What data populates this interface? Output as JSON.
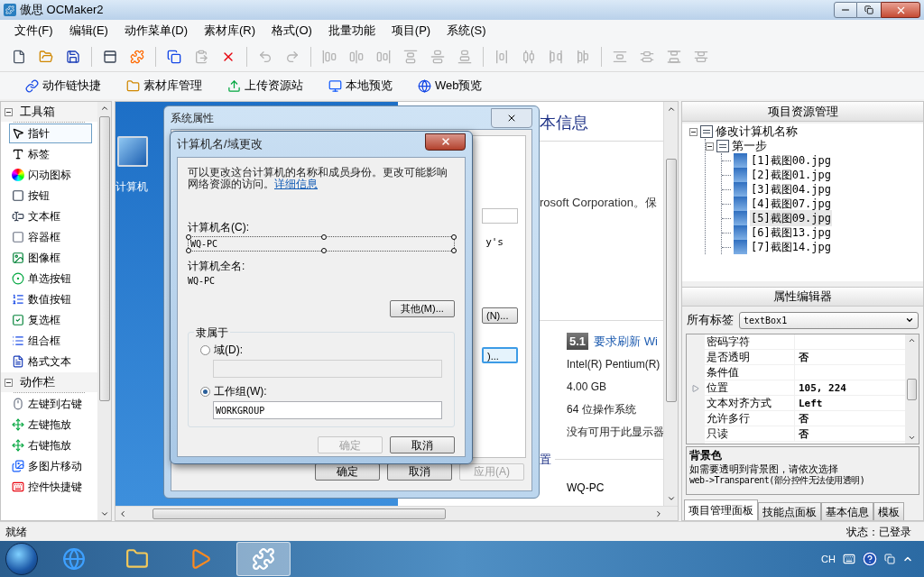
{
  "window": {
    "title": "傲思 OCMaker2"
  },
  "menu": [
    "文件(F)",
    "编辑(E)",
    "动作菜单(D)",
    "素材库(R)",
    "格式(O)",
    "批量功能",
    "项目(P)",
    "系统(S)"
  ],
  "toolbar": [
    [
      {
        "kind": "new",
        "disabled": false
      },
      {
        "kind": "open",
        "disabled": false
      },
      {
        "kind": "save",
        "disabled": false
      }
    ],
    [
      {
        "kind": "form",
        "disabled": false
      },
      {
        "kind": "puzzle",
        "disabled": false
      }
    ],
    [
      {
        "kind": "copy",
        "disabled": false
      },
      {
        "kind": "paste",
        "disabled": true
      },
      {
        "kind": "delete",
        "disabled": false
      }
    ],
    [
      {
        "kind": "undo",
        "disabled": true
      },
      {
        "kind": "redo",
        "disabled": true
      }
    ],
    [
      {
        "kind": "align-left",
        "disabled": true
      },
      {
        "kind": "align-center",
        "disabled": true
      },
      {
        "kind": "align-right",
        "disabled": true
      },
      {
        "kind": "align-top",
        "disabled": true
      },
      {
        "kind": "align-middle",
        "disabled": true
      },
      {
        "kind": "align-bottom",
        "disabled": true
      }
    ],
    [
      {
        "kind": "hspace-equal",
        "disabled": true
      },
      {
        "kind": "hspace-more",
        "disabled": true
      },
      {
        "kind": "hspace-less",
        "disabled": true
      },
      {
        "kind": "hspace-none",
        "disabled": true
      }
    ],
    [
      {
        "kind": "vspace-equal",
        "disabled": true
      },
      {
        "kind": "vspace-more",
        "disabled": true
      },
      {
        "kind": "vspace-less",
        "disabled": true
      },
      {
        "kind": "vspace-none",
        "disabled": true
      }
    ]
  ],
  "quick_actions": [
    {
      "kind": "chain",
      "label": "动作链快捷"
    },
    {
      "kind": "library",
      "label": "素材库管理"
    },
    {
      "kind": "upload",
      "label": "上传资源站"
    },
    {
      "kind": "local",
      "label": "本地预览"
    },
    {
      "kind": "web",
      "label": "Web预览"
    }
  ],
  "toolbox": [
    {
      "title": "工具箱",
      "expanded": true,
      "items": [
        {
          "kind": "pointer",
          "label": "指针",
          "selected": true
        },
        {
          "kind": "label",
          "label": "标签",
          "selected": false
        },
        {
          "kind": "flash",
          "label": "闪动图标",
          "selected": false
        },
        {
          "kind": "button",
          "label": "按钮",
          "selected": false
        },
        {
          "kind": "textbox",
          "label": "文本框",
          "selected": false
        },
        {
          "kind": "container",
          "label": "容器框",
          "selected": false
        },
        {
          "kind": "image",
          "label": "图像框",
          "selected": false
        },
        {
          "kind": "radio",
          "label": "单选按钮",
          "selected": false
        },
        {
          "kind": "numeric",
          "label": "数值按钮",
          "selected": false
        },
        {
          "kind": "checkbox",
          "label": "复选框",
          "selected": false
        },
        {
          "kind": "combo",
          "label": "组合框",
          "selected": false
        },
        {
          "kind": "richtext",
          "label": "格式文本",
          "selected": false
        }
      ]
    },
    {
      "title": "动作栏",
      "expanded": true,
      "items": [
        {
          "kind": "mouse",
          "label": "左键到右键",
          "selected": false
        },
        {
          "kind": "drag",
          "label": "左键拖放",
          "selected": false
        },
        {
          "kind": "drag",
          "label": "右键拖放",
          "selected": false
        },
        {
          "kind": "images",
          "label": "多图片移动",
          "selected": false
        },
        {
          "kind": "hotkey",
          "label": "控件快捷键",
          "selected": false
        }
      ]
    }
  ],
  "canvas": {
    "desktop_icon_label": "计算机",
    "info_page": {
      "heading": "本信息",
      "publisher": "rosoft Corporation。保",
      "rating": "5.1",
      "rating_link": "要求刷新 Wi",
      "specs": [
        "Intel(R) Pentium(R)",
        "4.00 GB",
        "64 位操作系统",
        "没有可用于此显示器"
      ],
      "section": "置",
      "computer_name": "WQ-PC"
    },
    "back_window": {
      "title": "系统属性",
      "partial_text": "y's",
      "partial_buttons": [
        {
          "label": "(N)...",
          "focused": false
        },
        {
          "label": ")...",
          "focused": true
        }
      ],
      "buttons": [
        {
          "label": "确定",
          "disabled": false
        },
        {
          "label": "取消",
          "disabled": false
        },
        {
          "label": "应用(A)",
          "disabled": true
        }
      ]
    },
    "dialog": {
      "title": "计算机名/域更改",
      "intro": "可以更改这台计算机的名称和成员身份。更改可能影响网络资源的访问。",
      "link": "详细信息",
      "name_label": "计算机名(C):",
      "name_value": "WQ-PC",
      "name_selected": true,
      "full_name_label": "计算机全名:",
      "full_name": "WQ-PC",
      "more_button": "其他(M)...",
      "member_group": "隶属于",
      "options": [
        {
          "label": "域(D):",
          "selected": false,
          "field_disabled": true
        },
        {
          "label": "工作组(W):",
          "selected": true,
          "field_disabled": false,
          "value": "WORKGROUP"
        }
      ],
      "buttons": [
        {
          "label": "确定",
          "disabled": true
        },
        {
          "label": "取消",
          "disabled": false
        }
      ]
    }
  },
  "resource_panel": {
    "title": "项目资源管理",
    "tree": [
      {
        "label": "修改计算机名称",
        "expanded": true,
        "children": [
          {
            "label": "第一步",
            "expanded": true,
            "children": [
              {
                "label": "[1]截图00.jpg",
                "selected": false
              },
              {
                "label": "[2]截图01.jpg",
                "selected": false
              },
              {
                "label": "[3]截图04.jpg",
                "selected": false
              },
              {
                "label": "[4]截图07.jpg",
                "selected": false
              },
              {
                "label": "[5]截图09.jpg",
                "selected": true
              },
              {
                "label": "[6]截图13.jpg",
                "selected": false
              },
              {
                "label": "[7]截图14.jpg",
                "selected": false
              }
            ]
          }
        ]
      }
    ]
  },
  "property_editor": {
    "title": "属性编辑器",
    "filter_label": "所有标签",
    "object": "textBox1",
    "rows": [
      {
        "kind": "plain",
        "name": "密码字符"
      },
      {
        "kind": "plain",
        "name": "是否透明",
        "value": "否"
      },
      {
        "kind": "plain",
        "name": "条件值"
      },
      {
        "kind": "group",
        "name": "位置",
        "value": "105, 224"
      },
      {
        "kind": "plain",
        "name": "文本对齐方式",
        "value": "Left"
      },
      {
        "kind": "plain",
        "name": "允许多行",
        "value": "否"
      },
      {
        "kind": "plain",
        "name": "只读",
        "value": "否"
      }
    ],
    "description": {
      "title": "背景色",
      "text": "如需要透明到背景图，请依次选择",
      "code": "web->Transparent(部分控件无法使用透明)"
    }
  },
  "bottom_tabs": [
    {
      "label": "项目管理面板",
      "selected": true
    },
    {
      "label": "技能点面板",
      "selected": false
    },
    {
      "label": "基本信息",
      "selected": false
    },
    {
      "label": "模板",
      "selected": false
    }
  ],
  "status_bar": {
    "left": "就绪",
    "right": "状态：已登录"
  },
  "taskbar": {
    "apps": [
      {
        "kind": "browser",
        "selected": false
      },
      {
        "kind": "folder",
        "selected": false
      },
      {
        "kind": "player",
        "selected": false
      },
      {
        "kind": "app",
        "selected": true
      }
    ],
    "language": "CH"
  }
}
